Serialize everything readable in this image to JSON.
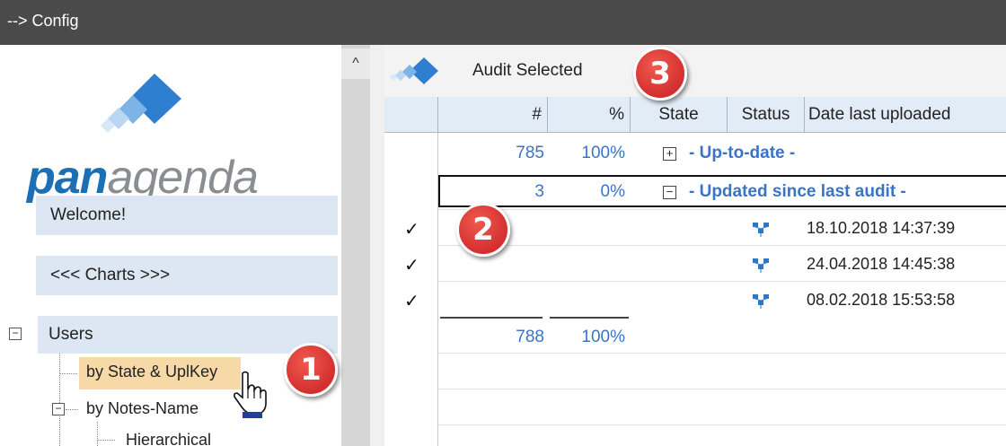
{
  "window": {
    "title": "--> Config"
  },
  "logo": {
    "bold_part": "pan",
    "light_part": "agenda"
  },
  "nav": {
    "welcome_label": "Welcome!",
    "charts_label": "<<< Charts >>>"
  },
  "tree": {
    "users_toggle": "−",
    "users_label": "Users",
    "by_state_label": "by State & UplKey",
    "notes_toggle": "−",
    "by_notes_label": "by Notes-Name",
    "hierarchical_label": "Hierarchical"
  },
  "scroll": {
    "up_arrow": "^"
  },
  "toolbar": {
    "audit_selected_label": "Audit Selected"
  },
  "grid": {
    "columns": [
      "#",
      "%",
      "State",
      "Status",
      "Date last uploaded"
    ],
    "groups": [
      {
        "toggle": "+",
        "count": "785",
        "percent": "100%",
        "label": "- Up-to-date -"
      },
      {
        "toggle": "−",
        "count": "3",
        "percent": "0%",
        "label": "- Updated since last audit -"
      }
    ],
    "rows": [
      {
        "check": "✓",
        "status_icon": "network-icon",
        "date": "18.10.2018 14:37:39"
      },
      {
        "check": "✓",
        "status_icon": "network-icon",
        "date": "24.04.2018 14:45:38"
      },
      {
        "check": "✓",
        "status_icon": "network-icon",
        "date": "08.02.2018 15:53:58"
      }
    ],
    "total": {
      "count": "788",
      "percent": "100%"
    }
  },
  "badges": [
    "1",
    "2",
    "3"
  ],
  "colors": {
    "accent_blue": "#3b74c5",
    "header_bg": "#e2ecf7",
    "nav_bg": "#dce7f3",
    "selection_bg": "#f7d9a8",
    "badge_red": "#d32f2f",
    "titlebar_bg": "#4a4a4a"
  }
}
